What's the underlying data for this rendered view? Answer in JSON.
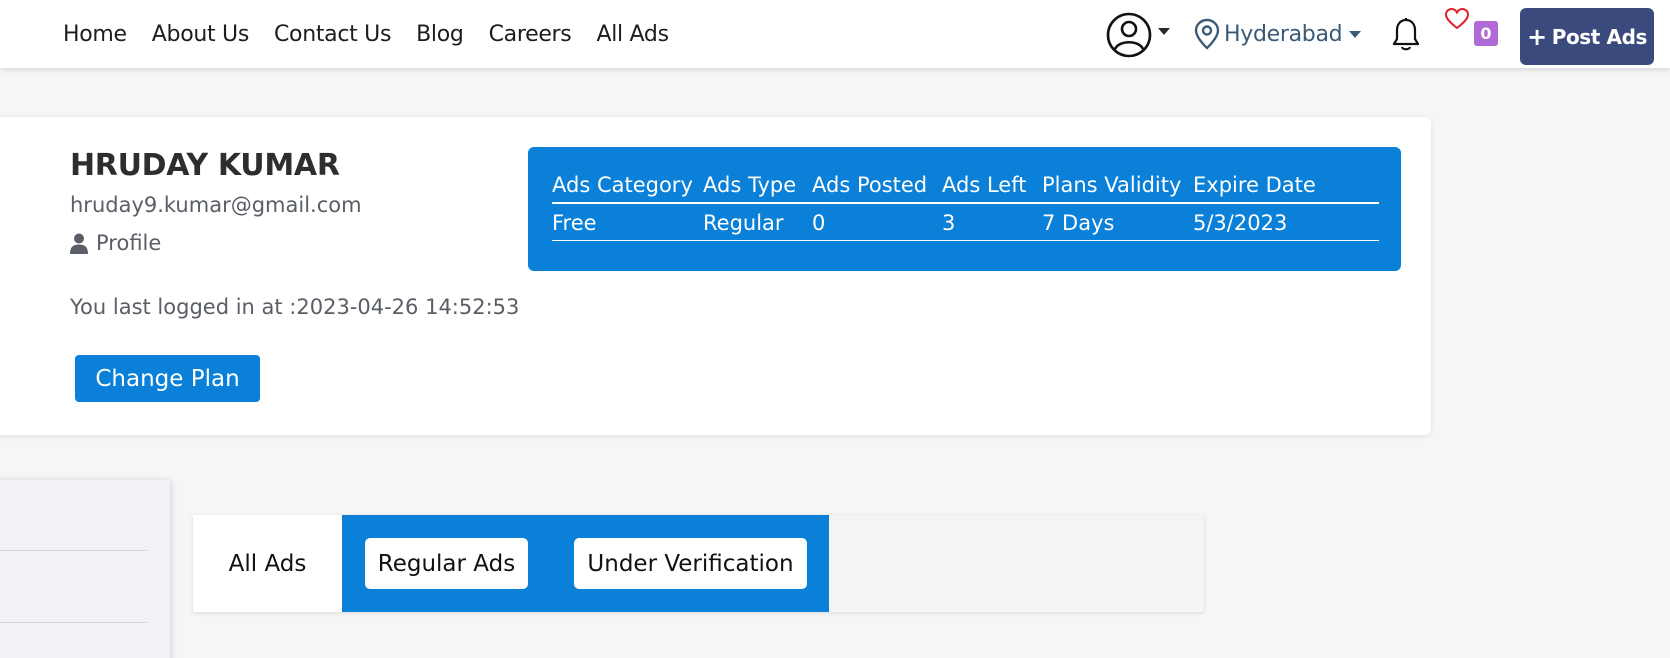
{
  "nav": {
    "links": [
      "Home",
      "About Us",
      "Contact Us",
      "Blog",
      "Careers",
      "All Ads"
    ],
    "location": "Hyderabad",
    "wishlist_count": "0",
    "post_ads_label": "Post Ads",
    "post_ads_icon": "+"
  },
  "profile": {
    "name": "HRUDAY KUMAR",
    "email": "hruday9.kumar@gmail.com",
    "profile_link": "Profile",
    "last_login": "You last logged in at :2023-04-26 14:52:53",
    "change_plan": "Change Plan"
  },
  "plan_table": {
    "headers": [
      "Ads Category",
      "Ads Type",
      "Ads Posted",
      "Ads Left",
      "Plans Validity",
      "Expire Date"
    ],
    "row": [
      "Free",
      "Regular",
      "0",
      "3",
      "7 Days",
      "5/3/2023"
    ]
  },
  "tabs": {
    "all": "All Ads",
    "regular": "Regular Ads",
    "verification": "Under Verification"
  },
  "colors": {
    "primary": "#0a80d8",
    "post_button": "#3a4a7c",
    "badge": "#b06bd6",
    "heart": "#e0202a"
  }
}
